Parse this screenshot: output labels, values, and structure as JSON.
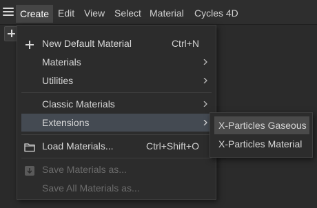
{
  "menubar": {
    "items": [
      "Create",
      "Edit",
      "View",
      "Select",
      "Material",
      "Cycles 4D"
    ],
    "active": "Create"
  },
  "dropdown": {
    "new_default_material": {
      "label": "New Default Material",
      "shortcut": "Ctrl+N"
    },
    "materials": {
      "label": "Materials"
    },
    "utilities": {
      "label": "Utilities"
    },
    "classic_materials": {
      "label": "Classic Materials"
    },
    "extensions": {
      "label": "Extensions"
    },
    "load_materials": {
      "label": "Load Materials...",
      "shortcut": "Ctrl+Shift+O"
    },
    "save_materials_as": {
      "label": "Save Materials as..."
    },
    "save_all_materials_as": {
      "label": "Save All Materials as..."
    }
  },
  "submenu": {
    "items": [
      "X-Particles Gaseous",
      "X-Particles Material"
    ],
    "highlighted": "X-Particles Gaseous"
  },
  "icons": {
    "hamburger": "hamburger-menu-icon",
    "plus": "plus-icon",
    "folder": "folder-icon",
    "save": "save-icon",
    "arrow": "chevron-right-icon"
  },
  "colors": {
    "background": "#2b2b2b",
    "menu_bg": "#2c2c2c",
    "highlight": "#444a52",
    "text": "#d8d8d8",
    "disabled_text": "#6b6b6b"
  }
}
